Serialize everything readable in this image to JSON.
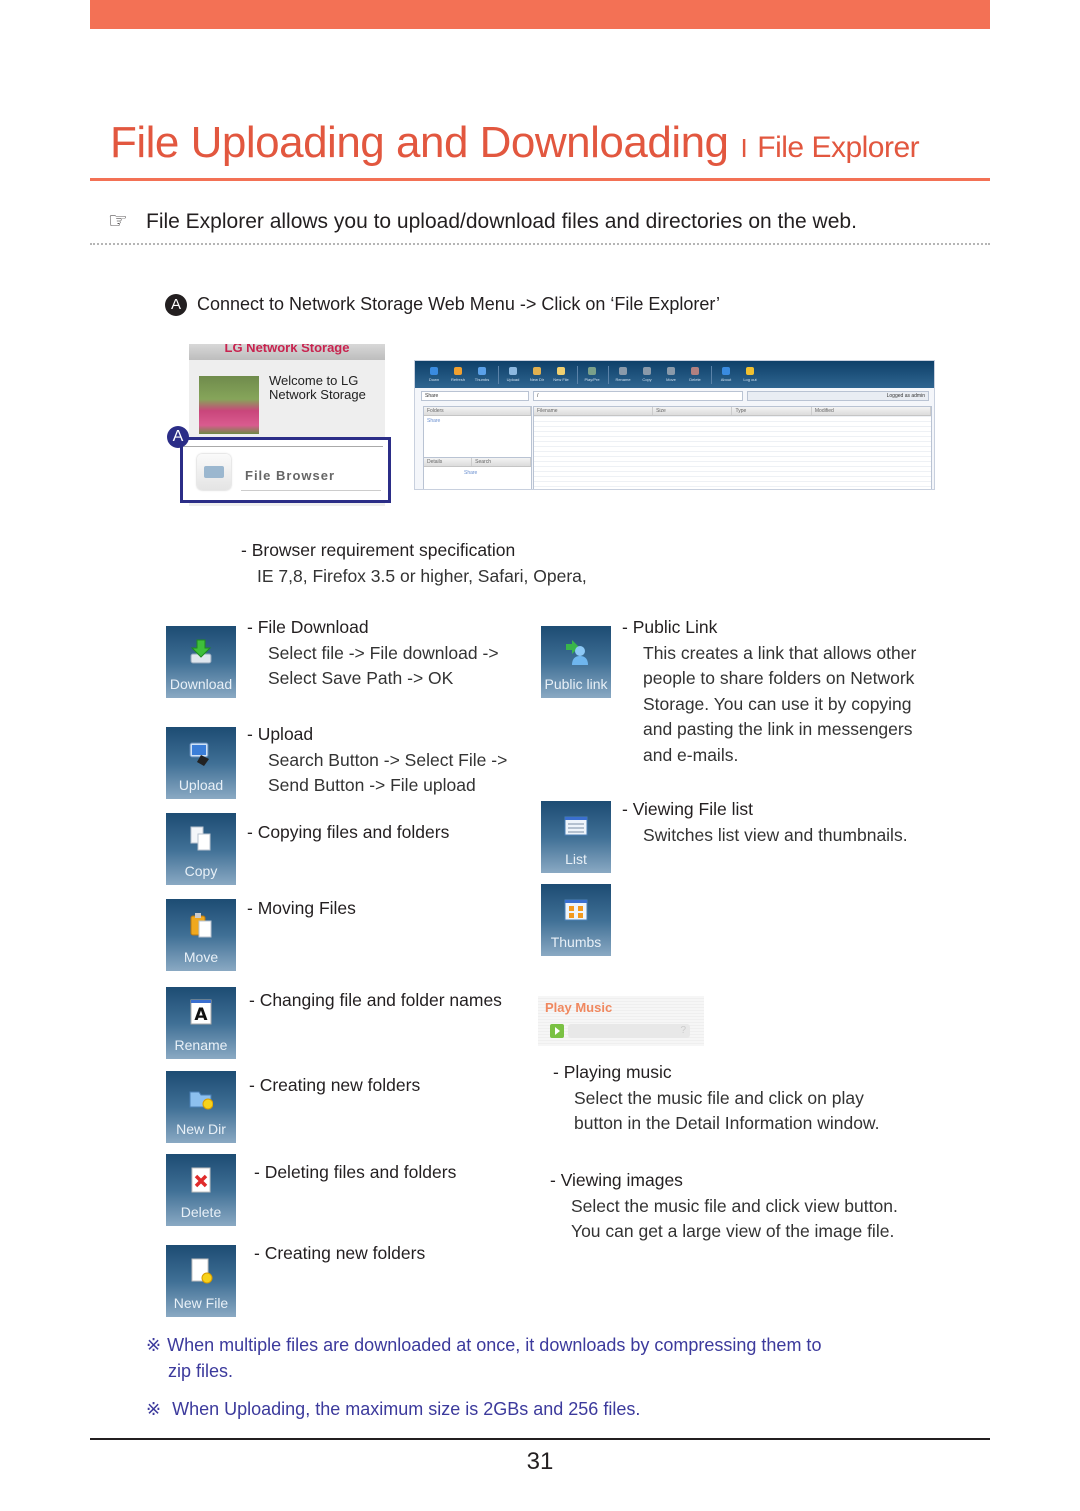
{
  "header": {
    "title": "File Uploading and Downloading",
    "separator": "I",
    "subtitle": "File Explorer",
    "accent_color": "#f37155"
  },
  "intro": {
    "icon": "pointing-hand-icon",
    "text": "File Explorer allows you to upload/download files and directories on the web."
  },
  "step_a": {
    "marker": "A",
    "text": "Connect to Network Storage Web Menu -> Click on ‘File Explorer’"
  },
  "lg_panel": {
    "header": "LG Network Storage",
    "welcome": "Welcome to LG Network Storage",
    "marker": "A",
    "menu_item": "File Browser"
  },
  "file_explorer": {
    "toolbar": [
      "Down",
      "Refresh",
      "Thumbs",
      "Upload",
      "New Dir",
      "New File",
      "Play/Pre",
      "Rename",
      "Copy",
      "Move",
      "Delete",
      "About",
      "Log out"
    ],
    "share_select": "Share",
    "path": "/",
    "logged_as": "Logged as admin",
    "folders_label": "Folders",
    "folder_item": "Share",
    "details_label": "Details",
    "search_label": "Search",
    "details_item": "Share",
    "columns": [
      "Filename",
      "Size",
      "Type",
      "Modified"
    ]
  },
  "browser_req": {
    "head": "- Browser requirement specification",
    "body": "IE 7,8, Firefox 3.5 or higher, Safari, Opera,"
  },
  "features_left": [
    {
      "icon_label": "Download",
      "icon": "download-icon",
      "head": "- File Download",
      "body": [
        "Select file -> File download ->",
        "Select Save Path -> OK"
      ]
    },
    {
      "icon_label": "Upload",
      "icon": "upload-icon",
      "head": "- Upload",
      "body": [
        "Search Button -> Select File ->",
        "Send Button -> File upload"
      ]
    },
    {
      "icon_label": "Copy",
      "icon": "copy-icon",
      "head": "- Copying files and folders",
      "body": []
    },
    {
      "icon_label": "Move",
      "icon": "move-icon",
      "head": "- Moving Files",
      "body": []
    },
    {
      "icon_label": "Rename",
      "icon": "rename-icon",
      "head": "- Changing file and folder names",
      "body": []
    },
    {
      "icon_label": "New Dir",
      "icon": "new-folder-icon",
      "head": "- Creating new folders",
      "body": []
    },
    {
      "icon_label": "Delete",
      "icon": "delete-icon",
      "head": "- Deleting files and folders",
      "body": []
    },
    {
      "icon_label": "New File",
      "icon": "new-file-icon",
      "head": "- Creating new folders",
      "body": []
    }
  ],
  "features_right": [
    {
      "icon_label": "Public link",
      "icon": "public-link-icon",
      "head": "- Public Link",
      "body": [
        "This creates a link that allows other",
        "people to share folders on Network",
        "Storage. You can use it by copying",
        "and pasting the link in messengers",
        "and e-mails."
      ]
    },
    {
      "icon_label": "List",
      "icon": "list-view-icon",
      "head": "- Viewing File list",
      "body": [
        "Switches list view and thumbnails."
      ]
    },
    {
      "icon_label": "Thumbs",
      "icon": "thumbs-view-icon"
    }
  ],
  "play_music": {
    "title": "Play Music",
    "bar_text": "?",
    "head": "- Playing music",
    "body": [
      "Select the music file and click on play",
      "button in the Detail Information window."
    ]
  },
  "view_images": {
    "head": "- Viewing images",
    "body": [
      "Select the music file and click view button.",
      "You can get a large view of the image file."
    ]
  },
  "notes": [
    {
      "mark": "※",
      "lines": [
        "When multiple files are downloaded at once, it downloads by compressing them to",
        "zip files."
      ]
    },
    {
      "mark": "※",
      "lines": [
        "When Uploading, the maximum size is 2GBs and 256 files."
      ]
    }
  ],
  "page_number": "31"
}
